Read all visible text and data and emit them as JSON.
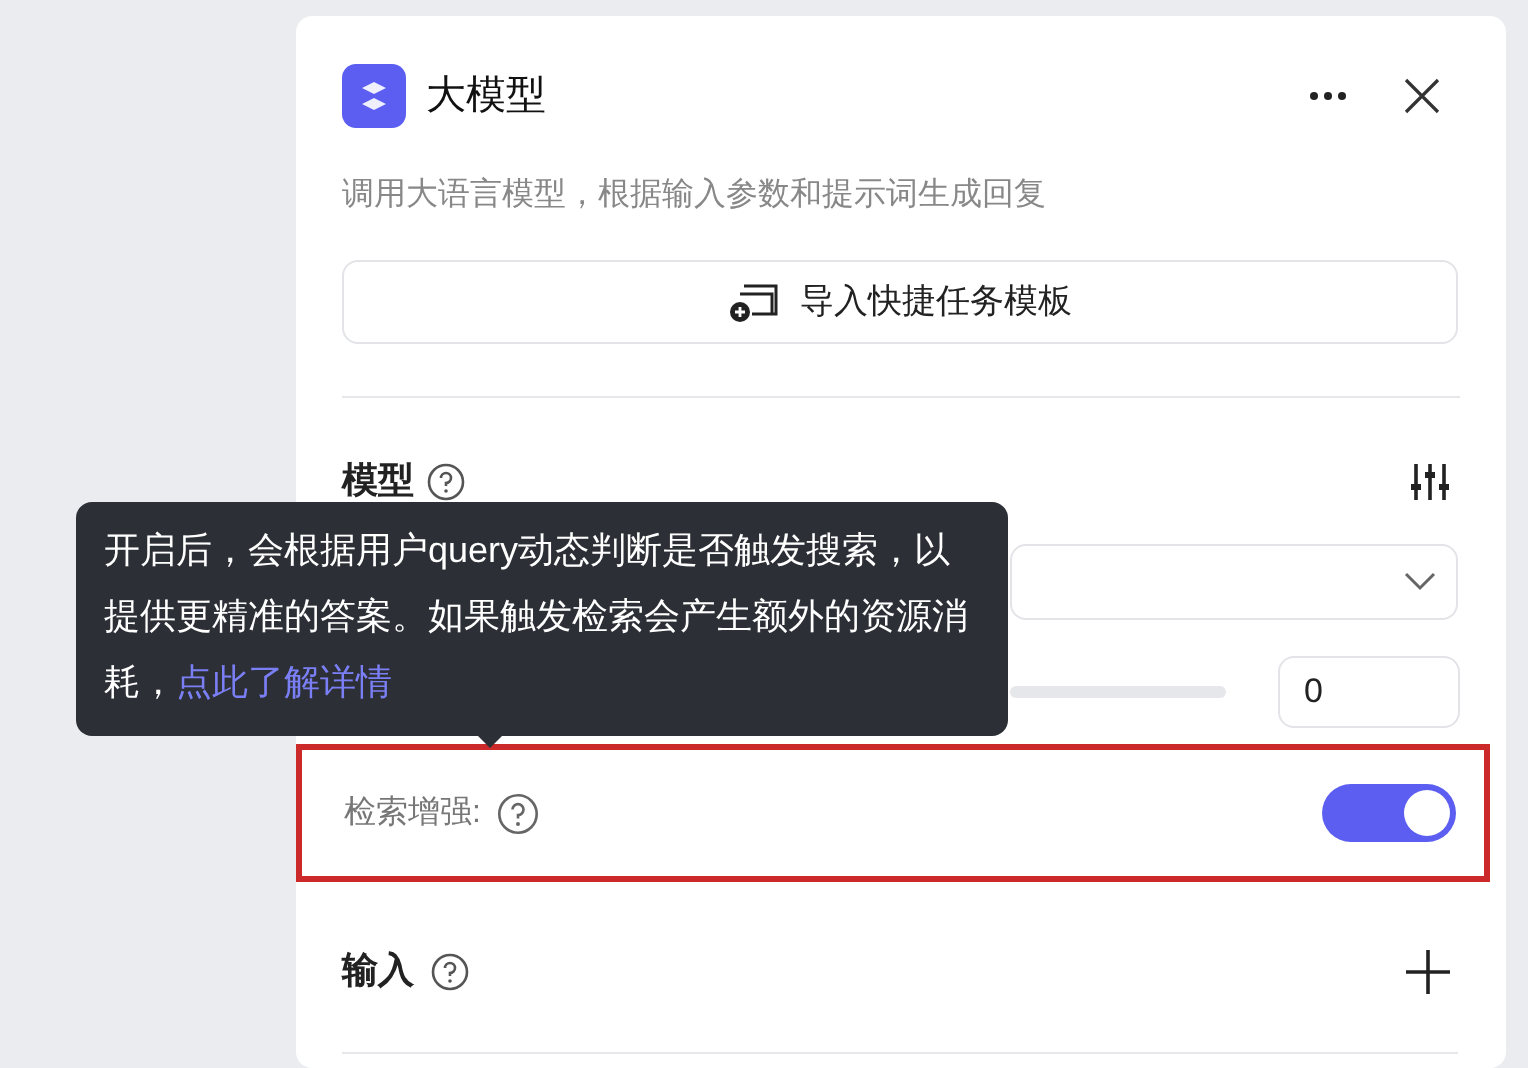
{
  "panel": {
    "title": "大模型",
    "description": "调用大语言模型，根据输入参数和提示词生成回复",
    "import_button": "导入快捷任务模板"
  },
  "model_section": {
    "title": "模型",
    "number_value": "0"
  },
  "search_enhance": {
    "label": "检索增强:",
    "on": true
  },
  "input_section": {
    "title": "输入"
  },
  "tooltip": {
    "text": "开启后，会根据用户query动态判断是否触发搜索，以提供更精准的答案。如果触发检索会产生额外的资源消耗，",
    "link": "点此了解详情"
  }
}
